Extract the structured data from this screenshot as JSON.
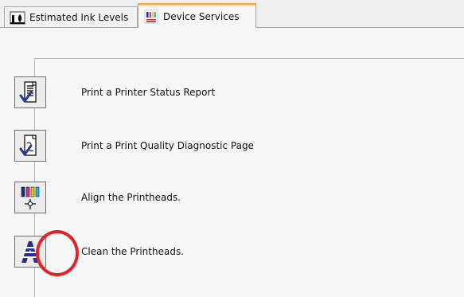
{
  "tabs": [
    {
      "label": "Estimated Ink Levels",
      "icon": "ink-levels-icon"
    },
    {
      "label": "Device Services",
      "icon": "device-services-icon"
    }
  ],
  "active_tab": "Device Services",
  "services": [
    {
      "label": "Print a Printer Status Report",
      "icon": "printer-status-report-icon"
    },
    {
      "label": "Print a Print Quality Diagnostic Page",
      "icon": "print-quality-diagnostic-icon"
    },
    {
      "label": "Align the Printheads.",
      "icon": "align-printheads-icon"
    },
    {
      "label": "Clean the Printheads.",
      "icon": "clean-printheads-icon"
    }
  ],
  "highlight": {
    "target": "Clean the Printheads.",
    "color": "#e32228"
  },
  "colors": {
    "background": "#f7f7f7",
    "active_tab_accent": "#f4a54a",
    "icon_blue": "#2c3e86"
  }
}
